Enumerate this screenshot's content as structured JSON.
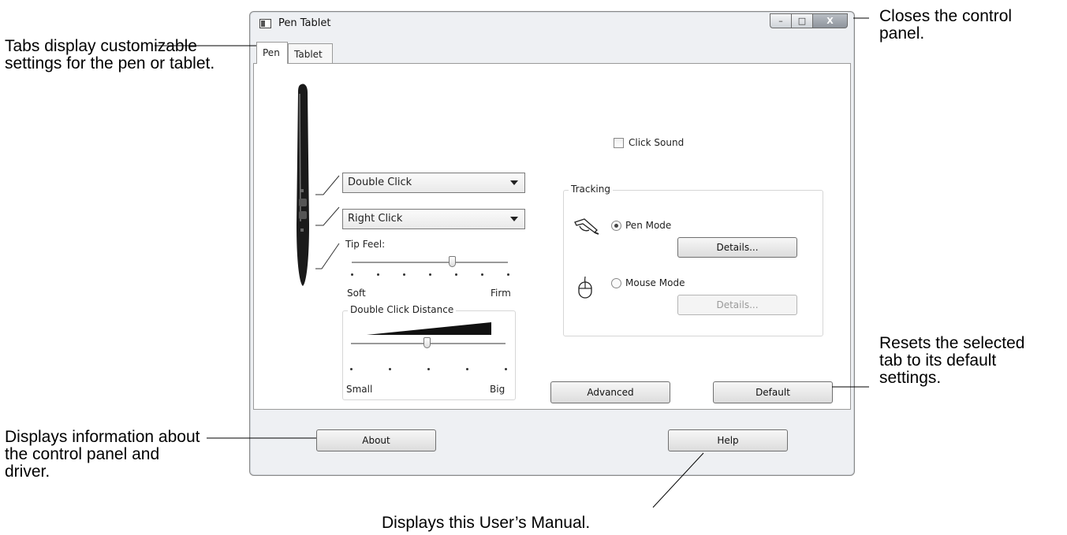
{
  "window": {
    "title": "Pen Tablet",
    "controls": {
      "minimize": "–",
      "maximize": "□",
      "close": "X"
    }
  },
  "tabs": [
    {
      "label": "Pen",
      "selected": true
    },
    {
      "label": "Tablet",
      "selected": false
    }
  ],
  "pen_panel": {
    "upper_button": "Double Click",
    "lower_button": "Right Click",
    "tip_feel": {
      "label": "Tip Feel:",
      "min_label": "Soft",
      "max_label": "Firm",
      "ticks": 7,
      "value_index": 4
    },
    "double_click_distance": {
      "label": "Double Click Distance",
      "min_label": "Small",
      "max_label": "Big",
      "ticks": 5,
      "value_index": 2
    },
    "click_sound": {
      "label": "Click Sound",
      "checked": false
    },
    "tracking": {
      "label": "Tracking",
      "pen_mode": {
        "label": "Pen Mode",
        "selected": true,
        "details": "Details..."
      },
      "mouse_mode": {
        "label": "Mouse Mode",
        "selected": false,
        "details": "Details..."
      }
    },
    "advanced_button": "Advanced",
    "default_button": "Default"
  },
  "footer": {
    "about_button": "About",
    "help_button": "Help"
  },
  "callouts": {
    "tabs": "Tabs display customizable settings for the pen or tablet.",
    "close": "Closes the control panel.",
    "reset": "Resets the selected tab to its default settings.",
    "about": "Displays information about the control panel and driver.",
    "help": "Displays this User’s Manual."
  },
  "icons": {
    "app": "window-icon",
    "pen_tool": "pen-tool-icon",
    "pen_mode": "pen-hand-icon",
    "mouse_mode": "mouse-icon",
    "dropdown": "chevron-down-icon"
  }
}
